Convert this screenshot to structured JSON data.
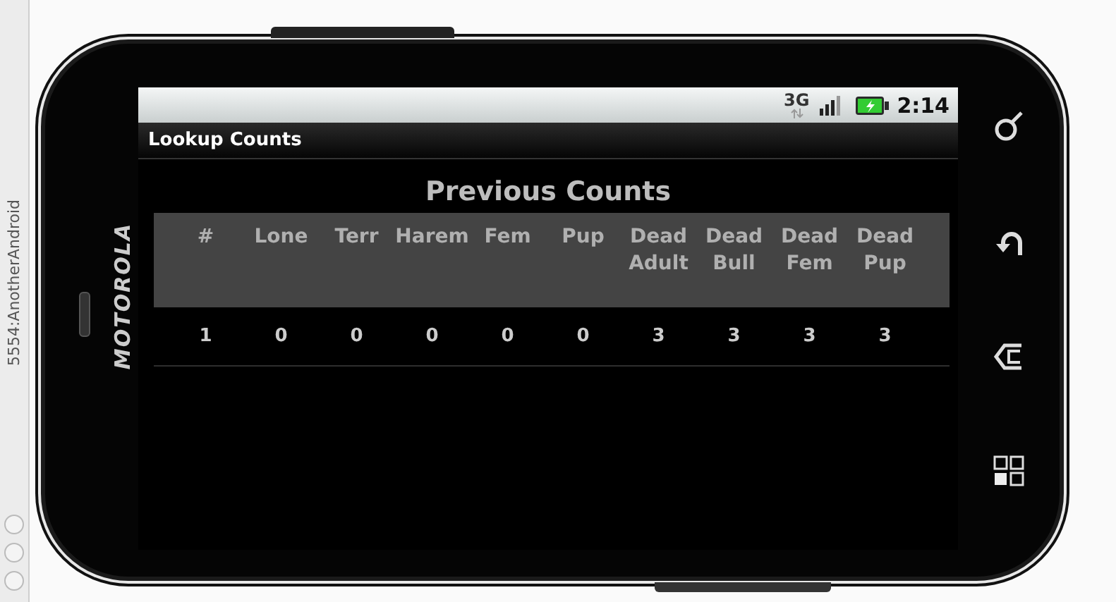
{
  "emulator": {
    "title": "5554:AnotherAndroid"
  },
  "device": {
    "brand": "MOTOROLA"
  },
  "status_bar": {
    "network": "3G",
    "time": "2:14"
  },
  "app_bar": {
    "title": "Lookup Counts"
  },
  "heading": "Previous Counts",
  "table": {
    "columns": [
      "#",
      "Lone",
      "Terr",
      "Harem",
      "Fem",
      "Pup",
      "Dead Adult",
      "Dead Bull",
      "Dead Fem",
      "Dead Pup"
    ],
    "rows": [
      [
        "1",
        "0",
        "0",
        "0",
        "0",
        "0",
        "3",
        "3",
        "3",
        "3"
      ]
    ]
  }
}
